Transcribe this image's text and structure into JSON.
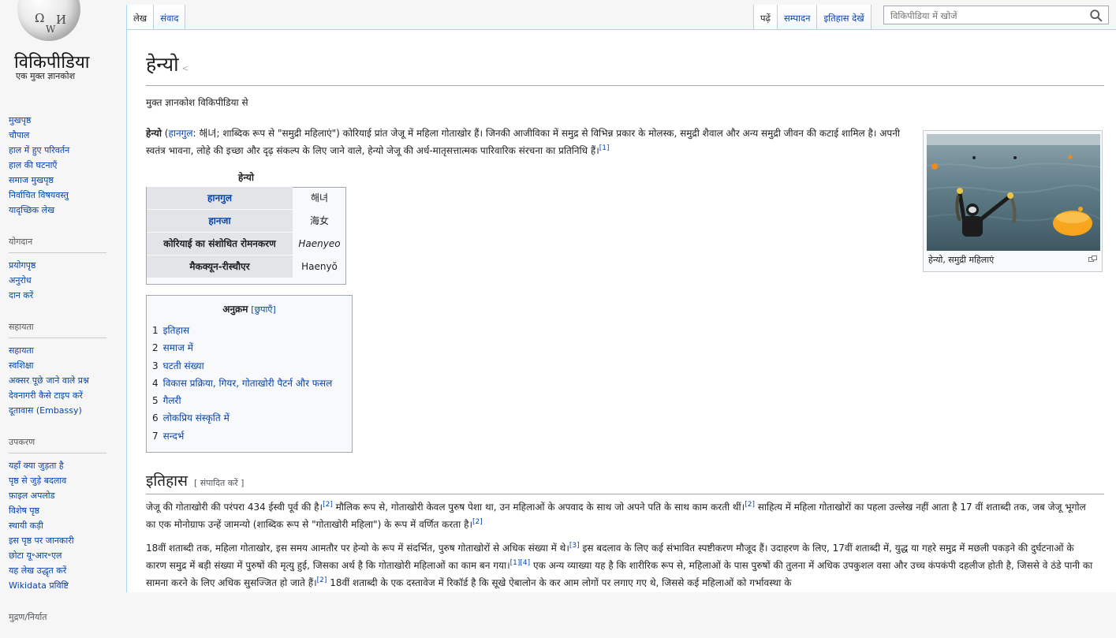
{
  "logo": {
    "title": "विकिपीडिया",
    "tagline": "एक मुक्त ज्ञानकोश",
    "globe_glyphs": [
      "Ω",
      "И",
      "W"
    ]
  },
  "sidebar": {
    "nav_items": [
      "मुखपृष्ठ",
      "चौपाल",
      "हाल में हुए परिवर्तन",
      "हाल की घटनाएँ",
      "समाज मुखपृष्ठ",
      "निर्वाचित विषयवस्तु",
      "यादृच्छिक लेख"
    ],
    "portals": [
      {
        "heading": "योगदान",
        "items": [
          "प्रयोगपृष्ठ",
          "अनुरोध",
          "दान करें"
        ]
      },
      {
        "heading": "सहायता",
        "items": [
          "सहायता",
          "स्वशिक्षा",
          "अक्सर पूछे जाने वाले प्रश्न",
          "देवनागरी कैसे टाइप करें",
          "दूतावास (Embassy)"
        ]
      },
      {
        "heading": "उपकरण",
        "items": [
          "यहाँ क्या जुड़ता है",
          "पृष्ठ से जुड़े बदलाव",
          "फ़ाइल अपलोड",
          "विशेष पृष्ठ",
          "स्थायी कड़ी",
          "इस पृष्ठ पर जानकारी",
          "छोटा यू॰आर॰एल",
          "यह लेख उद्धृत करें",
          "Wikidata प्रविष्टि"
        ]
      },
      {
        "heading": "मुद्रण/निर्यात",
        "items": []
      }
    ]
  },
  "tabs": {
    "left": [
      "लेख",
      "संवाद"
    ],
    "right": [
      "पढ़ें",
      "सम्पादन",
      "इतिहास देखें"
    ]
  },
  "search": {
    "placeholder": "विकिपीडिया में खोजें"
  },
  "article": {
    "title": "हेन्यो",
    "site_sub": "मुक्त ज्ञानकोश विकिपीडिया से",
    "lead": {
      "bold": "हेन्यो",
      "t1": " (",
      "hangul_link": "हानगुल",
      "t2": ": 해녀; शाब्दिक रूप से \"समुद्री महिलाएं\") कोरियाई प्रांत जेजू में महिला गोताखोर हैं। जिनकी आजीविका में समुद्र से विभिन्न प्रकार के मोलस्क, समुद्री शैवाल और अन्य समुद्री जीवन की कटाई शामिल है। अपनी स्वतंत्र भावना, लोहे की इच्छा और दृढ़ संकल्प के लिए जाने वाले, हेन्यो जेजू की अर्ध-मातृसत्तात्मक पारिवारिक संरचना का प्रतिनिधि हैं।",
      "ref": "[1]"
    },
    "infobox": {
      "caption": "हेन्यो",
      "rows": [
        {
          "label": "हानगुल",
          "value": "해녀"
        },
        {
          "label": "हानजा",
          "value": "海女"
        },
        {
          "label": "कोरियाई का संशोधित रोमनकरण",
          "value": "Haenyeo"
        },
        {
          "label": "मैकक्यून-रीस्चौएर",
          "value": "Haenyŏ"
        }
      ]
    },
    "thumb_caption": "हेन्यो, समुद्री महिलाएं",
    "toc": {
      "title": "अनुक्रम",
      "toggle": "[छुपाएँ]",
      "items": [
        {
          "num": "1",
          "text": "इतिहास"
        },
        {
          "num": "2",
          "text": "समाज में"
        },
        {
          "num": "3",
          "text": "घटती संख्या"
        },
        {
          "num": "4",
          "text": "विकास प्रक्रिया, गियर, गोताखोरी पैटर्न और फसल"
        },
        {
          "num": "5",
          "text": "गैलरी"
        },
        {
          "num": "6",
          "text": "लोकप्रिय संस्कृति में"
        },
        {
          "num": "7",
          "text": "सन्दर्भ"
        }
      ]
    },
    "history": {
      "heading": "इतिहास",
      "edit_link": "[ संपादित करें ]",
      "p1": {
        "t1": "जेजू की गोताखोरी की परंपरा 434 ईस्वी पूर्व की है।",
        "r1": "[2]",
        "t2": " मौलिक रूप से, गोताखोरी केवल पुरुष पेशा था, उन महिलाओं के अपवाद के साथ जो अपने पति के साथ काम करती थीं।",
        "r2": "[2]",
        "t3": " साहित्य में महिला गोताखोरों का पहला उल्लेख नहीं आता है 17 वीं शताब्दी तक, जब जेजू भूगोल का एक मोनोग्राफ उन्हें जामन्यो (शाब्दिक रूप से \"गोताखोरी महिला\") के रूप में वर्णित करता है।",
        "r3": "[2]"
      },
      "p2": {
        "t1": "18वीं शताब्दी तक, महिला गोताखोर, इस समय आमतौर पर हेन्यो के रूप में संदर्भित, पुरुष गोताखोरों से अधिक संख्या में थे।",
        "r1": "[3]",
        "t2": " इस बदलाव के लिए कई संभावित स्पष्टीकरण मौजूद हैं। उदाहरण के लिए, 17वीं शताब्दी में, युद्ध या गहरे समुद्र में मछली पकड़ने की दुर्घटनाओं के कारण समुद्र में बड़ी संख्या में पुरुषों की मृत्यु हुई, जिसका अर्थ है कि गोताखोरी महिलाओं का काम बन गया।",
        "r2": "[1]",
        "r3": "[4]",
        "t3": " एक अन्य व्याख्या यह है कि शारीरिक रूप से, महिलाओं के पास पुरुषों की तुलना में अधिक उपकुशल वसा और उच्च कंपकंपी दहलीज होती है, जिससे वे ठंडे पानी का सामना करने के लिए अधिक सुसज्जित हो जाते हैं।",
        "r4": "[2]",
        "t4": " 18वीं शताब्दी के एक दस्तावेज में रिकॉर्ड है कि सूखे ऐबालोन के कर आम लोगों पर लगाए गए थे, जिससे कई महिलाओं को गर्भावस्था के"
      }
    }
  },
  "colors": {
    "link": "#0645ad",
    "sidebar_bg": "#f6f6f6",
    "border": "#a2a9b1",
    "tab_border": "#a7d7f9"
  }
}
